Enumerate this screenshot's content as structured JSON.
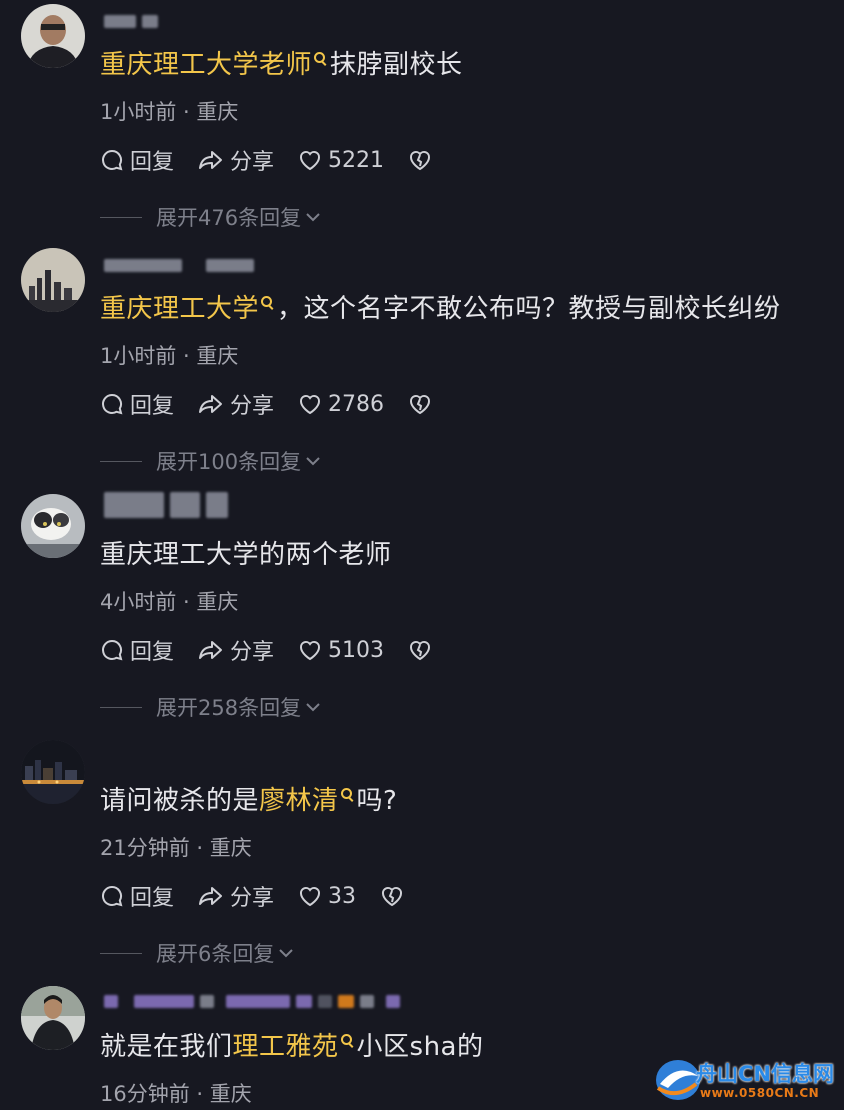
{
  "comments": [
    {
      "text_parts": [
        {
          "t": "重庆理工大学老师",
          "hl": true
        },
        {
          "t": "抹脖副校长",
          "hl": false
        }
      ],
      "meta": "1小时前 · 重庆",
      "reply_label": "回复",
      "share_label": "分享",
      "likes": "5221",
      "replies_label": "展开476条回复"
    },
    {
      "text_parts": [
        {
          "t": "重庆理工大学",
          "hl": true
        },
        {
          "t": "，这个名字不敢公布吗？教授与副校长纠纷",
          "hl": false
        }
      ],
      "meta": "1小时前 · 重庆",
      "reply_label": "回复",
      "share_label": "分享",
      "likes": "2786",
      "replies_label": "展开100条回复"
    },
    {
      "text_parts": [
        {
          "t": "重庆理工大学的两个老师",
          "hl": false
        }
      ],
      "meta": "4小时前 · 重庆",
      "reply_label": "回复",
      "share_label": "分享",
      "likes": "5103",
      "replies_label": "展开258条回复"
    },
    {
      "text_parts": [
        {
          "t": "请问被杀的是",
          "hl": false
        },
        {
          "t": "廖林清",
          "hl": true
        },
        {
          "t": "吗?",
          "hl": false
        }
      ],
      "meta": "21分钟前 · 重庆",
      "reply_label": "回复",
      "share_label": "分享",
      "likes": "33",
      "replies_label": "展开6条回复"
    },
    {
      "text_parts": [
        {
          "t": "就是在我们",
          "hl": false
        },
        {
          "t": "理工雅苑",
          "hl": true
        },
        {
          "t": "小区sha的",
          "hl": false
        }
      ],
      "meta": "16分钟前 · 重庆"
    }
  ],
  "watermark": {
    "title": "舟山CN信息网",
    "url": "www.0580CN.CN"
  },
  "colors": {
    "background": "#171821",
    "highlight": "#f3c64a",
    "text": "#e6e6ea",
    "meta": "#a3a4ad"
  }
}
